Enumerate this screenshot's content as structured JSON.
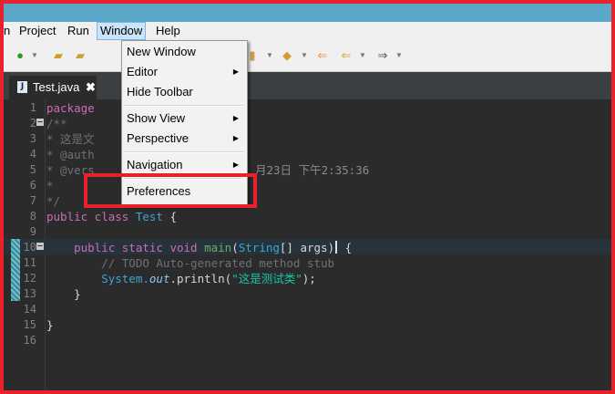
{
  "menubar": {
    "items": [
      {
        "label": "n"
      },
      {
        "label": "Project"
      },
      {
        "label": "Run"
      },
      {
        "label": "Window"
      },
      {
        "label": "Help"
      }
    ]
  },
  "tab": {
    "label": "Test.java",
    "close": "✖",
    "file_icon": "J"
  },
  "window_menu": {
    "items": [
      "New Window",
      "Editor",
      "Hide Toolbar",
      "Show View",
      "Perspective",
      "Navigation",
      "Preferences"
    ]
  },
  "editor": {
    "line_numbers": [
      "1",
      "2",
      "3",
      "4",
      "5",
      "6",
      "7",
      "8",
      "9",
      "10",
      "11",
      "12",
      "13",
      "14",
      "15",
      "16"
    ],
    "ghost_text": "月23日 下午2:35:36",
    "lines": {
      "l1": "package",
      "l2": "/**",
      "l3": "* 这是文",
      "l4": "* @auth",
      "l5": "* @vers",
      "l6": "*",
      "l7": "*/",
      "l8a": "public class",
      "l8b": " Test",
      "l8c": " {",
      "l10a": "    public static void",
      "l10b": " main",
      "l10c": "(",
      "l10d": "String",
      "l10e": "[] args",
      "l10f": ")",
      "l10g": " {",
      "l11": "        // TODO Auto-generated method stub",
      "l12a": "        System.",
      "l12b": "out",
      "l12c": ".println(",
      "l12d": "\"这是测试类\"",
      "l12e": ");",
      "l13": "    }",
      "l15": "}"
    }
  },
  "colors": {
    "highlight": "#e8212b",
    "titlebar": "#5aa7c8",
    "editor_bg": "#2b2b2b"
  }
}
